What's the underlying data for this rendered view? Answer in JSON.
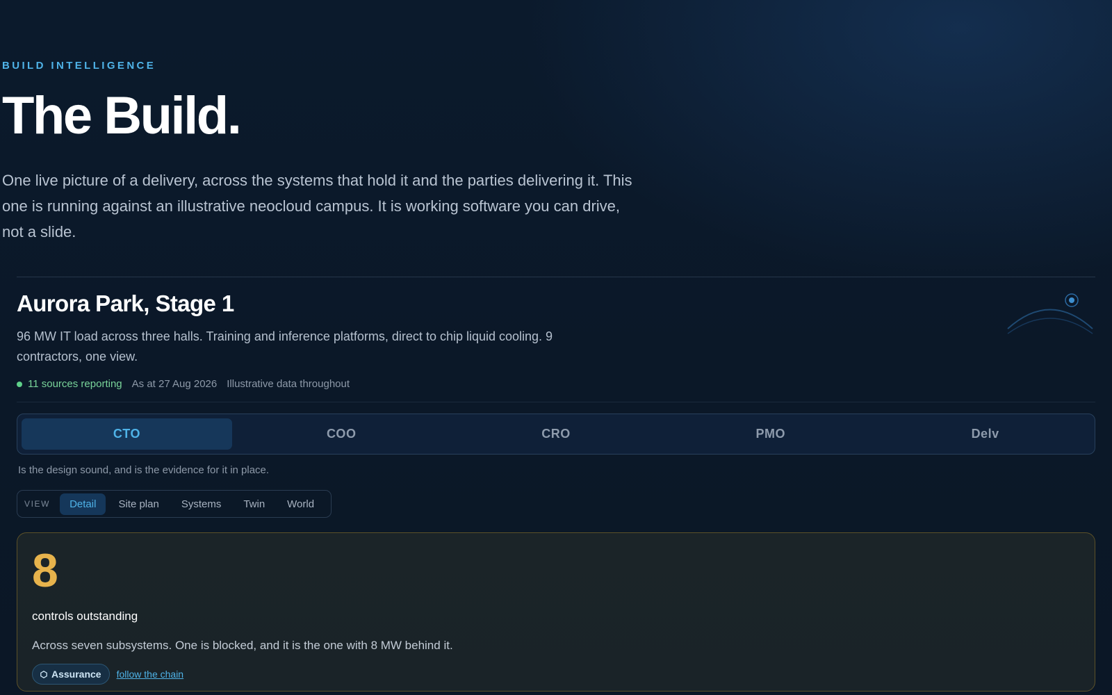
{
  "hero": {
    "eyebrow": "BUILD INTELLIGENCE",
    "title": "The Build.",
    "lede": "One live picture of a delivery, across the systems that hold it and the parties delivering it. This one is running against an illustrative neocloud campus. It is working software you can drive, not a slide."
  },
  "project": {
    "title": "Aurora Park, Stage 1",
    "description": "96 MW IT load across three halls. Training and inference platforms, direct to chip liquid cooling. 9 contractors, one view.",
    "sources": "11 sources reporting",
    "as_at": "As at 27 Aug 2026",
    "note": "Illustrative data throughout"
  },
  "roles": {
    "tabs": [
      "CTO",
      "COO",
      "CRO",
      "PMO",
      "Delv"
    ],
    "active": "CTO",
    "caption": "Is the design sound, and is the evidence for it in place."
  },
  "view": {
    "label": "VIEW",
    "options": [
      "Detail",
      "Site plan",
      "Systems",
      "Twin",
      "World"
    ],
    "active": "Detail"
  },
  "card": {
    "number": "8",
    "label": "controls outstanding",
    "body": "Across seven subsystems. One is blocked, and it is the one with 8 MW behind it.",
    "chip": "Assurance",
    "link": "follow the chain"
  },
  "colors": {
    "accent": "#4fb3e8",
    "amber": "#e7b34c",
    "status_green": "#5fd08a"
  }
}
